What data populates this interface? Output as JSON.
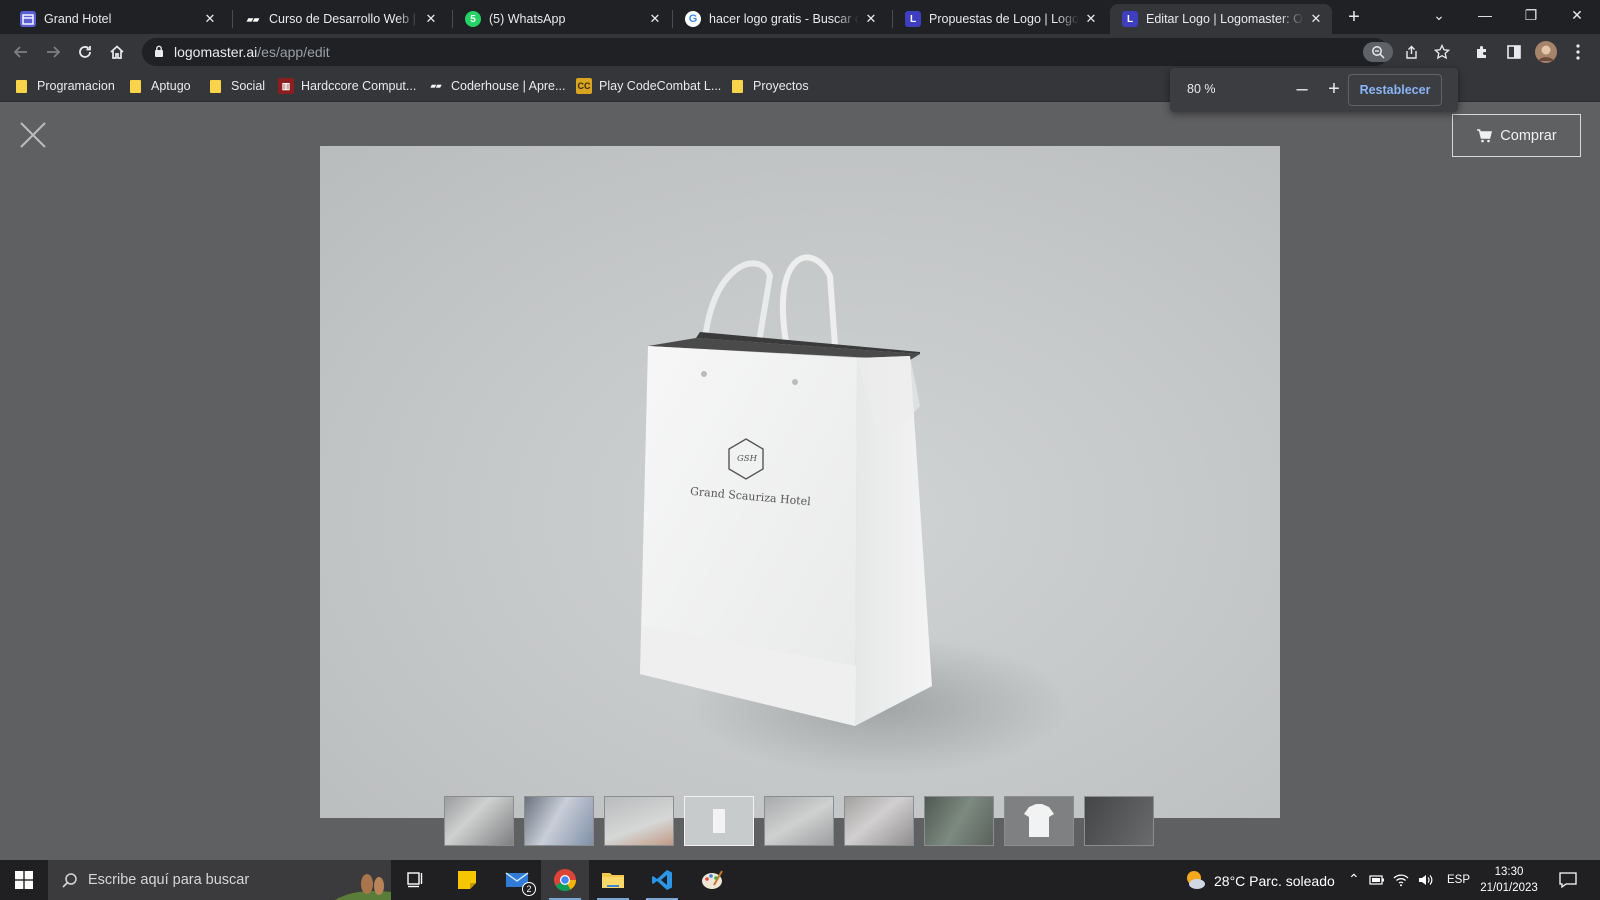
{
  "browser": {
    "tabs": [
      {
        "label": "Grand Hotel",
        "icon": "calendar-icon",
        "color": "#5b5fd6"
      },
      {
        "label": "Curso de Desarrollo Web | Pla",
        "icon": "coderhouse-icon",
        "color": "#ffffff"
      },
      {
        "label": "(5) WhatsApp",
        "icon": "whatsapp-icon",
        "color": "#25d366"
      },
      {
        "label": "hacer logo gratis - Buscar cor",
        "icon": "google-icon",
        "color": "#ffffff"
      },
      {
        "label": "Propuestas de Logo | Logoma",
        "icon": "logomaster-icon",
        "color": "#3d3fbf"
      },
      {
        "label": "Editar Logo | Logomaster: On",
        "icon": "logomaster-icon",
        "color": "#3d3fbf"
      }
    ],
    "url_host": "logomaster.ai",
    "url_path": "/es/app/edit",
    "bookmarks": [
      {
        "label": "Programacion",
        "type": "folder"
      },
      {
        "label": "Aptugo",
        "type": "folder"
      },
      {
        "label": "Social",
        "type": "folder"
      },
      {
        "label": "Hardccore Comput...",
        "type": "site"
      },
      {
        "label": "Coderhouse | Apre...",
        "type": "site"
      },
      {
        "label": "Play CodeCombat L...",
        "type": "site"
      },
      {
        "label": "Proyectos",
        "type": "folder"
      }
    ],
    "zoom": {
      "value": "80 %",
      "minus": "–",
      "plus": "+",
      "reset_label": "Restablecer"
    }
  },
  "page": {
    "buy_label": "Comprar",
    "logo": {
      "monogram": "GSH",
      "text": "Grand Scauriza Hotel"
    },
    "thumbnails": [
      {
        "name": "building-mockup"
      },
      {
        "name": "phone-mockup"
      },
      {
        "name": "card-hand-mockup"
      },
      {
        "name": "bag-mockup",
        "selected": true
      },
      {
        "name": "envelope-mockup"
      },
      {
        "name": "stationery-mockup"
      },
      {
        "name": "storefront-mockup"
      },
      {
        "name": "tshirt-mockup"
      },
      {
        "name": "dark-mockup"
      }
    ]
  },
  "taskbar": {
    "search_placeholder": "Escribe aquí para buscar",
    "mail_badge": "2",
    "weather": "28°C  Parc. soleado",
    "language": "ESP",
    "time": "13:30",
    "date": "21/01/2023"
  }
}
